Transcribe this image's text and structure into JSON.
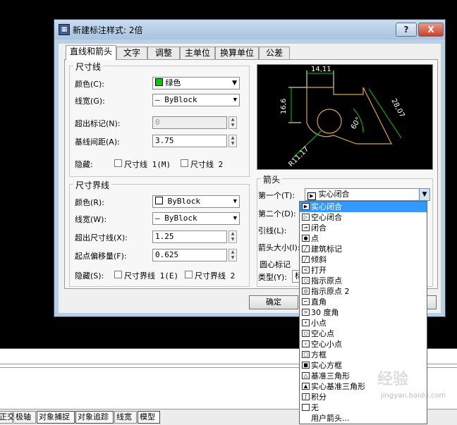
{
  "window": {
    "title": "新建标注样式: 2倍",
    "help_label": "?",
    "close_label": "X"
  },
  "tabs": [
    {
      "label": "直线和箭头",
      "active": true
    },
    {
      "label": "文字"
    },
    {
      "label": "调整"
    },
    {
      "label": "主单位"
    },
    {
      "label": "换算单位"
    },
    {
      "label": "公差"
    }
  ],
  "dimension_line": {
    "group_title": "尺寸线",
    "color_label": "颜色(C):",
    "color_value": "绿色",
    "color_hex": "#00cc00",
    "lineweight_label": "线宽(G):",
    "lineweight_value": "— ByBlock",
    "extend_label": "超出标记(N):",
    "extend_value": "0",
    "spacing_label": "基线间距(A):",
    "spacing_value": "3.75",
    "suppress_label": "隐藏:",
    "suppress1": "尺寸线 1(M)",
    "suppress2": "尺寸线 2"
  },
  "extension_line": {
    "group_title": "尺寸界线",
    "color_label": "颜色(R):",
    "color_value": "ByBlock",
    "lineweight_label": "线宽(W):",
    "lineweight_value": "— ByBlock",
    "extend_label": "超出尺寸线(X):",
    "extend_value": "1.25",
    "offset_label": "起点偏移量(F):",
    "offset_value": "0.625",
    "suppress_label": "隐藏(S):",
    "suppress1": "尺寸界线 1(E)",
    "suppress2": "尺寸界线 2"
  },
  "preview": {
    "dim_top": "14,11",
    "dim_left": "16,6",
    "dim_right": "28,07",
    "dim_angle": "60°",
    "dim_radius": "R11,17"
  },
  "arrowheads": {
    "group_title": "箭头",
    "first_label": "第一个(T):",
    "first_value": "实心闭合",
    "second_label": "第二个(D):",
    "leader_label": "引线(L):",
    "size_label": "箭头大小(I):",
    "center_label": "圆心标记",
    "type_label": "类型(Y):",
    "type_value": "标"
  },
  "buttons": {
    "ok": "确定"
  },
  "dropdown_items": [
    {
      "label": "实心闭合",
      "selected": true,
      "icon": "▶"
    },
    {
      "label": "空心闭合",
      "icon": "▷"
    },
    {
      "label": "闭合",
      "icon": "⇒"
    },
    {
      "label": "点",
      "icon": "●"
    },
    {
      "label": "建筑标记",
      "icon": "╱"
    },
    {
      "label": "倾斜",
      "icon": "╱"
    },
    {
      "label": "打开",
      "icon": "<"
    },
    {
      "label": "指示原点",
      "icon": "○"
    },
    {
      "label": "指示原点 2",
      "icon": "◎"
    },
    {
      "label": "直角",
      "icon": "⌐"
    },
    {
      "label": "30 度角",
      "icon": ">"
    },
    {
      "label": "小点",
      "icon": "•"
    },
    {
      "label": "空心点",
      "icon": "○"
    },
    {
      "label": "空心小点",
      "icon": "∘"
    },
    {
      "label": "方框",
      "icon": "□"
    },
    {
      "label": "实心方框",
      "icon": "■"
    },
    {
      "label": "基准三角形",
      "icon": "△"
    },
    {
      "label": "实心基准三角形",
      "icon": "▲"
    },
    {
      "label": "积分",
      "icon": "∫"
    },
    {
      "label": "无",
      "icon": ""
    },
    {
      "label": "用户箭头...",
      "icon": null
    }
  ],
  "statusbar": [
    {
      "label": "正交"
    },
    {
      "label": "极轴"
    },
    {
      "label": "对象捕捉",
      "on": true
    },
    {
      "label": "对象追踪",
      "on": true
    },
    {
      "label": "线宽"
    },
    {
      "label": "模型",
      "on": true
    }
  ],
  "watermark": {
    "text": "经验",
    "url": "jingyan.baidu.com"
  }
}
